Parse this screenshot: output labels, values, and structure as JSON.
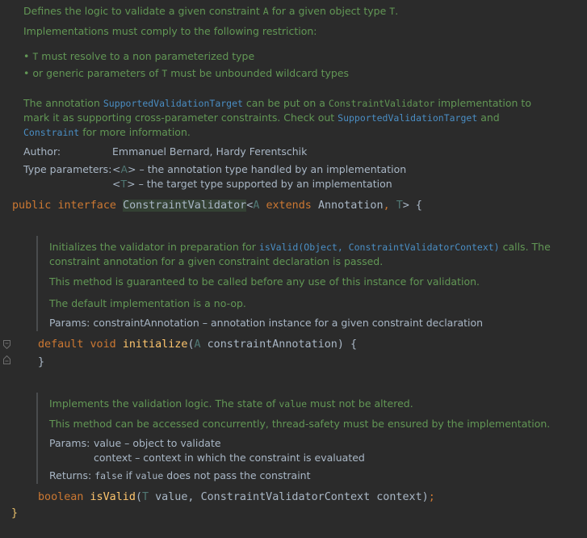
{
  "top_doc": {
    "line1_pre": "Defines the logic to validate a given constraint ",
    "line1_a": "A",
    "line1_mid": " for a given object type ",
    "line1_t": "T",
    "line1_end": ".",
    "line2": "Implementations must comply to the following restriction:",
    "bullet1_t": "T",
    "bullet1_rest": " must resolve to a non parameterized type",
    "bullet2_pre": "or generic parameters of ",
    "bullet2_t": "T",
    "bullet2_rest": " must be unbounded wildcard types",
    "para_pre": "The annotation ",
    "para_link1": "SupportedValidationTarget",
    "para_mid1": " can be put on a ",
    "para_mono1": "ConstraintValidator",
    "para_mid2": " implementation to",
    "para2_pre": "mark it as supporting cross-parameter constraints. Check out ",
    "para2_link": "SupportedValidationTarget",
    "para2_end": " and",
    "para3_link": "Constraint",
    "para3_end": " for more information.",
    "author_label": "Author:",
    "author_value": "Emmanuel Bernard, Hardy Ferentschik",
    "typeparams_label": "Type parameters:",
    "tp1_open": "<",
    "tp1_name": "A",
    "tp1_close": ">",
    "tp1_desc": " – the annotation type handled by an implementation",
    "tp2_open": "<",
    "tp2_name": "T",
    "tp2_close": ">",
    "tp2_desc": " – the target type supported by an implementation"
  },
  "decl": {
    "public": "public",
    "interface": "interface",
    "name": "ConstraintValidator",
    "lt": "<",
    "a": "A",
    "extends": "extends",
    "annotation": "Annotation",
    "comma": ", ",
    "t": "T",
    "gt": ">",
    "brace": " {"
  },
  "init_doc": {
    "l1_pre": "Initializes the validator in preparation for ",
    "l1_link": "isValid(Object, ConstraintValidatorContext)",
    "l1_end": " calls. The",
    "l2": "constraint annotation for a given constraint declaration is passed.",
    "l3": "This method is guaranteed to be called before any use of this instance for validation.",
    "l4": "The default implementation is a no-op.",
    "params_label": "Params:",
    "params_value": "constraintAnnotation – annotation instance for a given constraint declaration"
  },
  "init_code": {
    "default": "default",
    "void": "void",
    "method": "initialize",
    "paren_open": "(",
    "type": "A",
    "param": " constraintAnnotation",
    "paren_close": ")",
    "brace_open": " {",
    "brace_close": "}"
  },
  "valid_doc": {
    "l1_pre": "Implements the validation logic. The state of ",
    "l1_mono": "value",
    "l1_end": " must not be altered.",
    "l2": "This method can be accessed concurrently, thread-safety must be ensured by the implementation.",
    "params_label": "Params:",
    "param1": "value – object to validate",
    "param2": "context – context in which the constraint is evaluated",
    "returns_label": "Returns:",
    "returns_mono1": "false",
    "returns_mid": " if ",
    "returns_mono2": "value",
    "returns_end": " does not pass the constraint"
  },
  "valid_code": {
    "boolean": "boolean",
    "method": "isValid",
    "paren_open": "(",
    "type": "T",
    "p1": " value, ",
    "ctx_type": "ConstraintValidatorContext",
    "p2": " context",
    "paren_close": ")",
    "semi": ";"
  },
  "closing_brace": "}"
}
